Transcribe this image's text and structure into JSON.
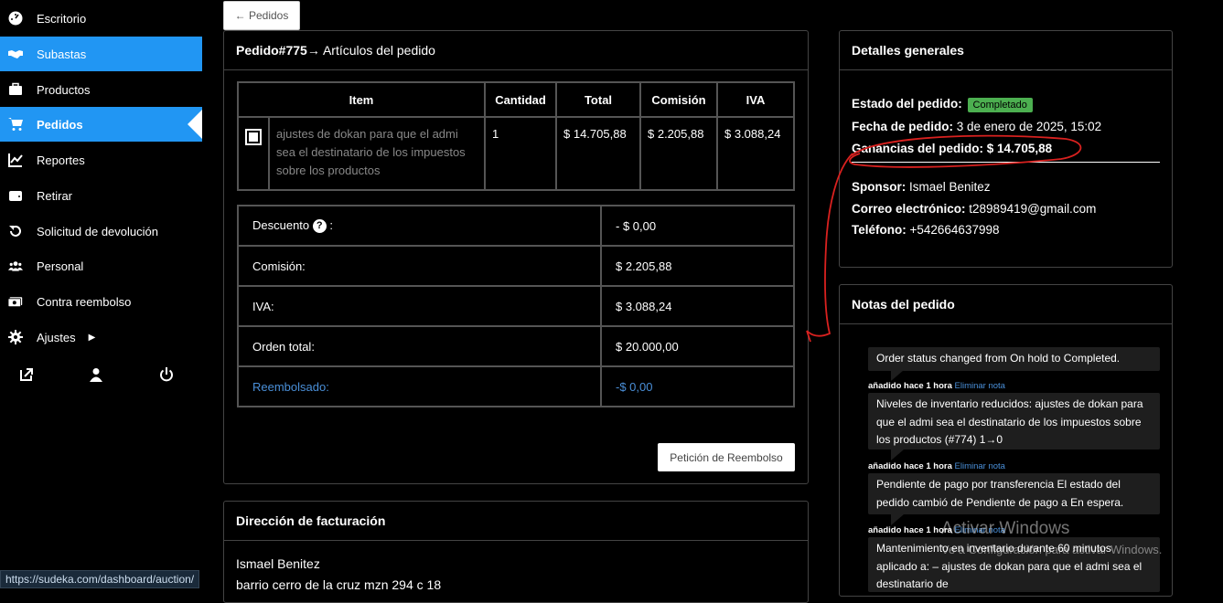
{
  "sidebar": {
    "items": [
      {
        "label": "Escritorio",
        "icon": "dashboard-icon"
      },
      {
        "label": "Subastas",
        "icon": "handshake-icon"
      },
      {
        "label": "Productos",
        "icon": "briefcase-icon"
      },
      {
        "label": "Pedidos",
        "icon": "cart-icon"
      },
      {
        "label": "Reportes",
        "icon": "chart-line-icon"
      },
      {
        "label": "Retirar",
        "icon": "wallet-icon"
      },
      {
        "label": "Solicitud de devolución",
        "icon": "undo-icon"
      },
      {
        "label": "Personal",
        "icon": "users-icon"
      },
      {
        "label": "Contra reembolso",
        "icon": "money-icon"
      },
      {
        "label": "Ajustes",
        "icon": "gear-icon"
      }
    ],
    "status_url": "https://sudeka.com/dashboard/auction/"
  },
  "back_button": "← Pedidos",
  "order": {
    "title_bold": "Pedido#775",
    "title_rest": " → Artículos del pedido",
    "columns": [
      "Item",
      "Cantidad",
      "Total",
      "Comisión",
      "IVA"
    ],
    "item": {
      "name": "ajustes de dokan para que el admi sea el destinatario de los impuestos sobre los productos",
      "qty": "1",
      "total": "$ 14.705,88",
      "commission": "$ 2.205,88",
      "iva": "$ 3.088,24"
    },
    "totals": {
      "discount_label": "Descuento",
      "discount_value": "- $ 0,00",
      "commission_label": "Comisión:",
      "commission_value": "$ 2.205,88",
      "iva_label": "IVA:",
      "iva_value": "$ 3.088,24",
      "order_total_label": "Orden total:",
      "order_total_value": "$ 20.000,00",
      "refunded_label": "Reembolsado:",
      "refunded_value": "-$ 0,00"
    },
    "refund_button": "Petición de Reembolso"
  },
  "billing": {
    "title": "Dirección de facturación",
    "name": "Ismael Benitez",
    "address": "barrio cerro de la cruz mzn 294 c 18"
  },
  "details": {
    "title": "Detalles generales",
    "status_label": "Estado del pedido:",
    "status_value": "Completado",
    "date_label": "Fecha de pedido:",
    "date_value": " 3 de enero de 2025, 15:02",
    "earnings_label": "Ganancias del pedido:",
    "earnings_value": " $ 14.705,88",
    "sponsor_label": "Sponsor:",
    "sponsor_value": " Ismael Benitez",
    "email_label": "Correo electrónico:",
    "email_value": " t28989419@gmail.com",
    "phone_label": "Teléfono:",
    "phone_value": " +542664637998"
  },
  "notes": {
    "title": "Notas del pedido",
    "items": [
      {
        "text": "Order status changed from On hold to Completed.",
        "meta": "añadido hace 1 hora",
        "delete": "Eliminar nota"
      },
      {
        "text": "Niveles de inventario reducidos: ajustes de dokan para que el admi sea el destinatario de los impuestos sobre los productos (#774) 1→0",
        "meta": "añadido hace 1 hora",
        "delete": "Eliminar nota"
      },
      {
        "text": "Pendiente de pago por transferencia El estado del pedido cambió de Pendiente de pago a En espera.",
        "meta": "añadido hace 1 hora",
        "delete": "Eliminar nota"
      },
      {
        "text": "Mantenimiento en inventario durante 60 minutos aplicado a: – ajustes de dokan para que el admi sea el destinatario de"
      }
    ]
  },
  "watermark": {
    "line1": "Activar Windows",
    "line2": "Ve a Configuración para activar Windows."
  },
  "annotation_color": "#d9211f"
}
